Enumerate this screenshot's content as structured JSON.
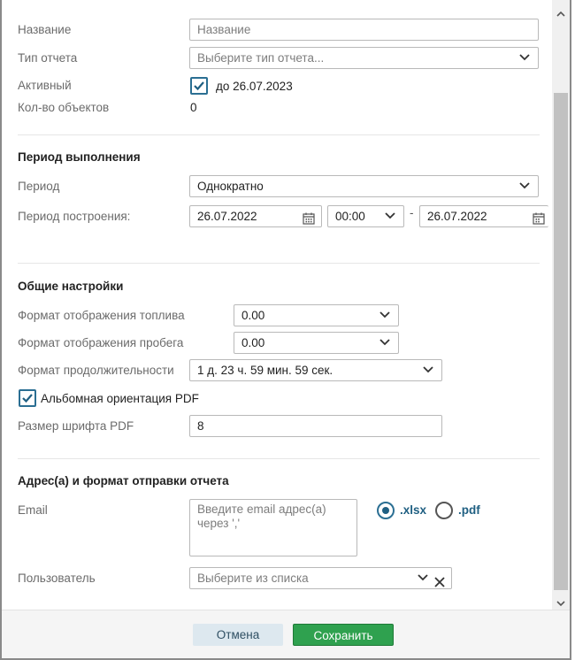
{
  "form": {
    "name_label": "Название",
    "name_placeholder": "Название",
    "report_type_label": "Тип отчета",
    "report_type_placeholder": "Выберите тип отчета...",
    "active_label": "Активный",
    "active_checked": true,
    "active_until": "до 26.07.2023",
    "objects_count_label": "Кол-во объектов",
    "objects_count_value": "0"
  },
  "period": {
    "section_title": "Период выполнения",
    "period_label": "Период",
    "period_value": "Однократно",
    "build_period_label": "Период построения:",
    "date_from": "26.07.2022",
    "time_from": "00:00",
    "separator": "-",
    "date_to": "26.07.2022"
  },
  "general": {
    "section_title": "Общие настройки",
    "fuel_format_label": "Формат отображения топлива",
    "fuel_format_value": "0.00",
    "mileage_format_label": "Формат отображения пробега",
    "mileage_format_value": "0.00",
    "duration_format_label": "Формат продолжительности",
    "duration_format_value": "1 д. 23 ч. 59 мин. 59 сек.",
    "landscape_label": "Альбомная ориентация PDF",
    "landscape_checked": true,
    "font_size_label": "Размер шрифта PDF",
    "font_size_value": "8"
  },
  "delivery": {
    "section_title": "Адрес(а) и формат отправки отчета",
    "email_label": "Email",
    "email_placeholder": "Введите email адрес(а)\nчерез ','",
    "formats": [
      {
        "label": ".xlsx",
        "selected": true
      },
      {
        "label": ".pdf",
        "selected": false
      }
    ],
    "user_label": "Пользователь",
    "user_placeholder": "Выберите из списка"
  },
  "footer": {
    "cancel_label": "Отмена",
    "save_label": "Сохранить"
  },
  "colors": {
    "accent": "#2b6f93",
    "save": "#2fa14f",
    "cancel_bg": "#dde8ef"
  },
  "icons": [
    "chevron-down-icon",
    "calendar-icon",
    "check-icon",
    "close-icon",
    "scroll-up-icon",
    "scroll-down-icon"
  ]
}
